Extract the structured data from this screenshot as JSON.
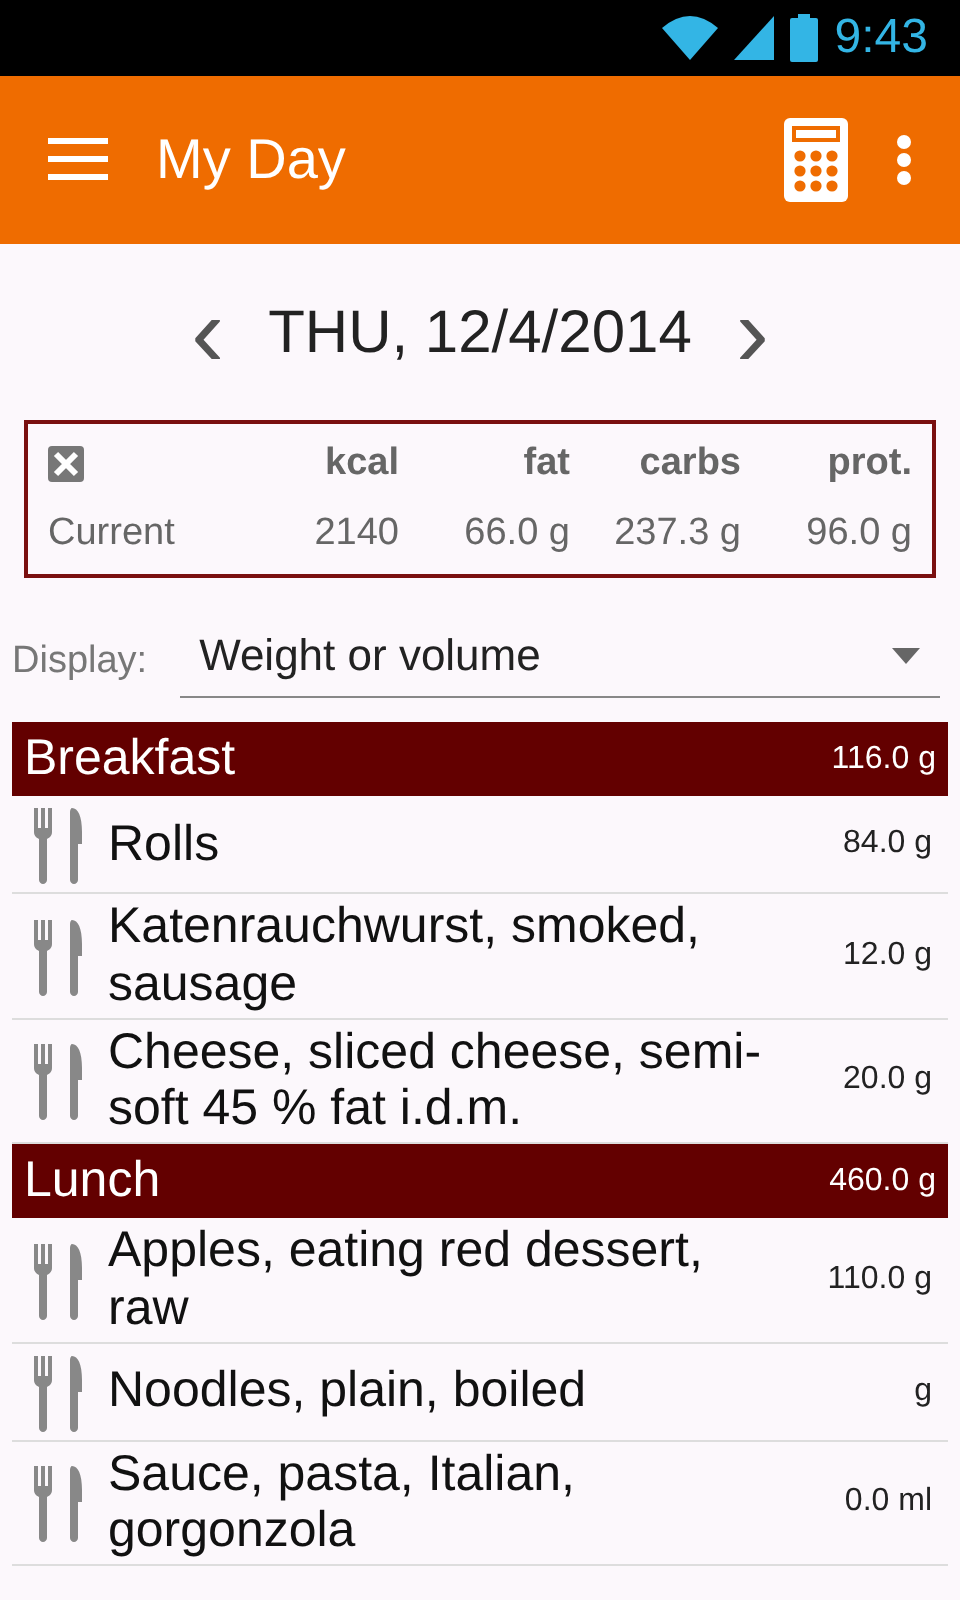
{
  "status_bar": {
    "time": "9:43"
  },
  "app_bar": {
    "title": "My Day"
  },
  "date_nav": {
    "prev": "‹",
    "date": "THU, 12/4/2014",
    "next": "›"
  },
  "summary": {
    "columns": [
      "kcal",
      "fat",
      "carbs",
      "prot."
    ],
    "row_label": "Current",
    "values": [
      "2140",
      "66.0 g",
      "237.3 g",
      "96.0 g"
    ]
  },
  "display": {
    "label": "Display:",
    "value": "Weight or volume"
  },
  "meals": [
    {
      "name": "Breakfast",
      "total": "116.0 g",
      "items": [
        {
          "name": "Rolls",
          "amount": "84.0 g"
        },
        {
          "name": "Katenrauchwurst, smoked, sausage",
          "amount": "12.0 g"
        },
        {
          "name": "Cheese, sliced cheese, semi-soft 45 % fat i.d.m.",
          "amount": "20.0 g"
        }
      ]
    },
    {
      "name": "Lunch",
      "total": "460.0 g",
      "items": [
        {
          "name": "Apples, eating red dessert, raw",
          "amount": "110.0 g"
        },
        {
          "name": "Noodles, plain, boiled",
          "amount": "g"
        },
        {
          "name": "Sauce, pasta, Italian, gorgonzola",
          "amount": "0.0 ml"
        }
      ]
    }
  ]
}
